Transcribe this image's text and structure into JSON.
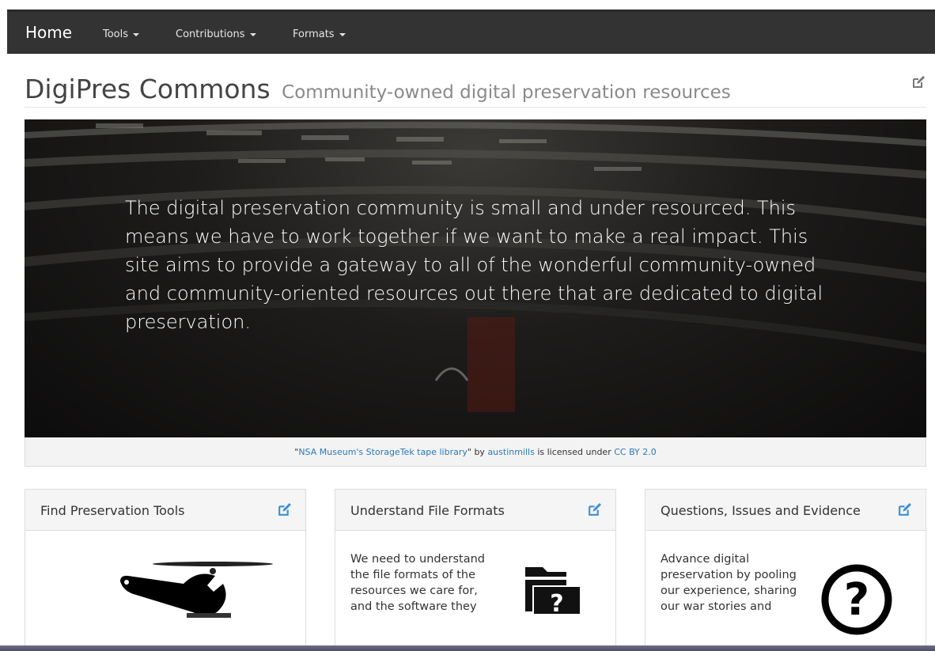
{
  "navbar": {
    "brand": "Home",
    "items": [
      {
        "label": "Tools"
      },
      {
        "label": "Contributions"
      },
      {
        "label": "Formats"
      }
    ]
  },
  "header": {
    "title": "DigiPres Commons",
    "subtitle": "Community-owned digital preservation resources",
    "edit_icon": "edit-icon"
  },
  "hero": {
    "text": "The digital preservation community is small and under resourced. This means we have to work together if we want to make a real impact. This site aims to provide a gateway to all of the wonderful community-owned and community-oriented resources out there that are dedicated to digital preservation."
  },
  "caption": {
    "open_quote": "\"",
    "work_title": "NSA Museum's StorageTek tape library",
    "close_by": "\" by ",
    "author": "austinmills",
    "licensed": " is licensed under ",
    "license": "CC BY 2.0"
  },
  "panels": [
    {
      "title": "Find Preservation Tools",
      "text": "",
      "icon": "wrench-icon"
    },
    {
      "title": "Understand File Formats",
      "text": "We need to understand the file formats of the resources we care for, and the software they",
      "icon": "folder-question-icon"
    },
    {
      "title": "Questions, Issues and Evidence",
      "text": "Advance digital preservation by pooling our experience, sharing our war stories and",
      "icon": "question-circle-icon"
    }
  ],
  "colors": {
    "navbar": "#333333",
    "link": "#2a7ab8",
    "edit_icon": "#3a8fd6"
  }
}
